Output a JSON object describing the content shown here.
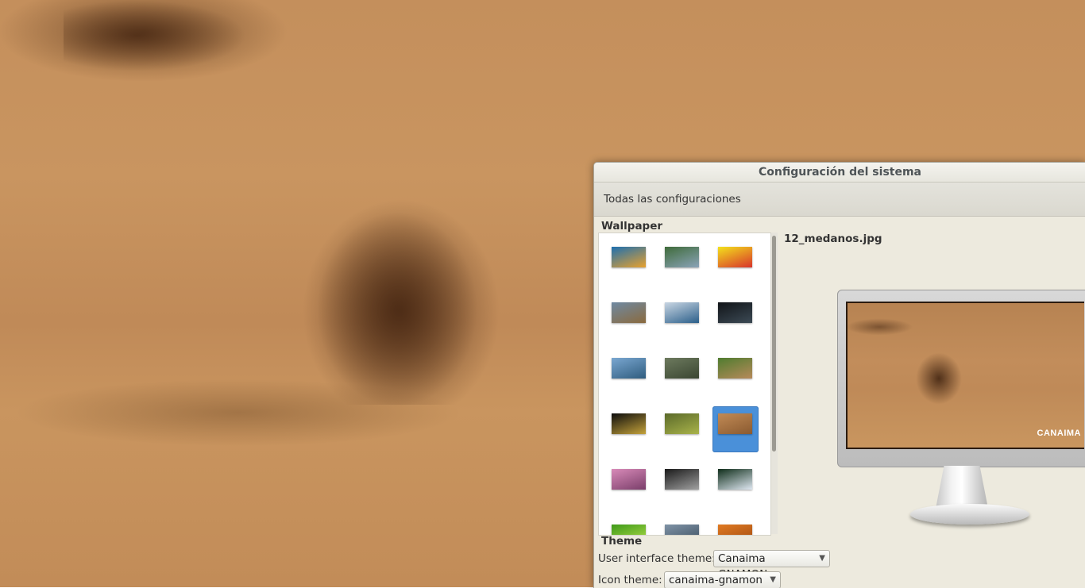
{
  "window": {
    "title": "Configuración del sistema",
    "breadcrumb": "Todas las configuraciones"
  },
  "wallpaper": {
    "heading": "Wallpaper",
    "selected_filename": "12_medanos.jpg",
    "preview_logo": "CANAIMA",
    "thumbnails": [
      {
        "name": "wallpaper-1",
        "colors": [
          "#1d6fb0",
          "#e8a12e"
        ]
      },
      {
        "name": "wallpaper-2",
        "colors": [
          "#3f6b3a",
          "#8aa3b8"
        ]
      },
      {
        "name": "wallpaper-3",
        "colors": [
          "#f3e21c",
          "#d8332b"
        ]
      },
      {
        "name": "wallpaper-4",
        "colors": [
          "#6f8aa3",
          "#8a6a3e"
        ]
      },
      {
        "name": "wallpaper-5",
        "colors": [
          "#c9d6e3",
          "#2b5f8a"
        ]
      },
      {
        "name": "wallpaper-6",
        "colors": [
          "#111418",
          "#3c4a55"
        ]
      },
      {
        "name": "wallpaper-7",
        "colors": [
          "#7aa7d1",
          "#2f5c7e"
        ]
      },
      {
        "name": "wallpaper-8",
        "colors": [
          "#6d7a5e",
          "#3a4632"
        ]
      },
      {
        "name": "wallpaper-9",
        "colors": [
          "#4f7c2f",
          "#b78a5a"
        ]
      },
      {
        "name": "wallpaper-10",
        "colors": [
          "#0d0d0d",
          "#c4a23a"
        ]
      },
      {
        "name": "wallpaper-11",
        "colors": [
          "#5b6a2a",
          "#a9b34a"
        ]
      },
      {
        "name": "wallpaper-12",
        "colors": [
          "#c18a55",
          "#8a5a30"
        ],
        "selected": true
      },
      {
        "name": "wallpaper-13",
        "colors": [
          "#d88ab8",
          "#7a3e6a"
        ]
      },
      {
        "name": "wallpaper-14",
        "colors": [
          "#1a1a1a",
          "#a0a0a0"
        ]
      },
      {
        "name": "wallpaper-15",
        "colors": [
          "#0f2d1a",
          "#dfe8f2"
        ]
      },
      {
        "name": "wallpaper-16",
        "colors": [
          "#3f9a1a",
          "#b6e04a"
        ]
      },
      {
        "name": "wallpaper-17",
        "colors": [
          "#7f93a6",
          "#3b4d5e"
        ]
      },
      {
        "name": "wallpaper-18",
        "colors": [
          "#e07a22",
          "#a04a12"
        ]
      }
    ]
  },
  "theme": {
    "heading": "Theme",
    "ui_theme_label": "User interface theme:",
    "ui_theme_value": "Canaima GNAMON",
    "icon_theme_label": "Icon theme:",
    "icon_theme_value": "canaima-gnamon"
  }
}
